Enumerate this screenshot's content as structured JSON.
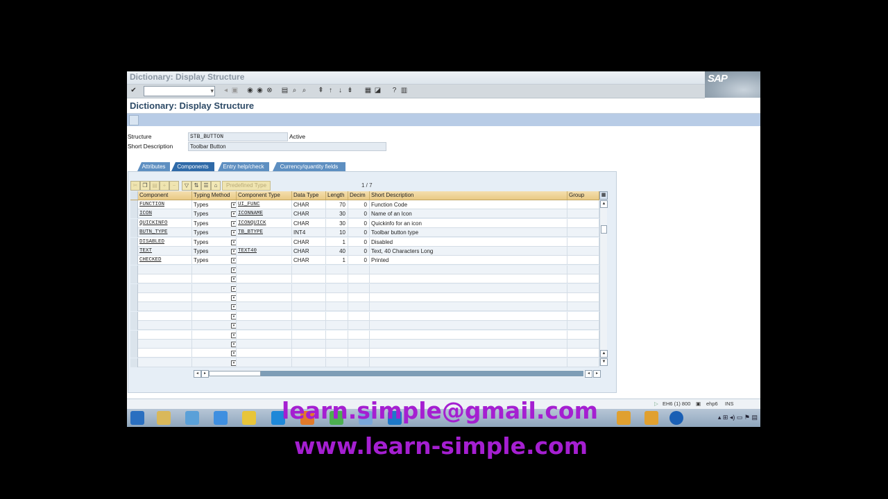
{
  "window": {
    "title": "Dictionary: Display Structure",
    "sap_logo": "SAP"
  },
  "page": {
    "title": "Dictionary: Display Structure"
  },
  "header": {
    "structure_label": "Structure",
    "structure_value": "STB_BUTTON",
    "status": "Active",
    "short_desc_label": "Short Description",
    "short_desc_value": "Toolbar Button"
  },
  "tabs": [
    {
      "label": "Attributes",
      "active": false
    },
    {
      "label": "Components",
      "active": true
    },
    {
      "label": "Entry help/check",
      "active": false
    },
    {
      "label": "Currency/quantity fields",
      "active": false
    }
  ],
  "table_toolbar": {
    "predefined_type_label": "Predefined Type",
    "counter": "1 / 7"
  },
  "columns": [
    "Component",
    "Typing Method",
    "Component Type",
    "Data Type",
    "Length",
    "Decim",
    "Short Description",
    "Group"
  ],
  "rows": [
    {
      "component": "FUNCTION",
      "typing": "Types",
      "comp_type": "UI_FUNC",
      "data_type": "CHAR",
      "length": "70",
      "decim": "0",
      "desc": "Function Code"
    },
    {
      "component": "ICON",
      "typing": "Types",
      "comp_type": "ICONNAME",
      "data_type": "CHAR",
      "length": "30",
      "decim": "0",
      "desc": "Name of an Icon"
    },
    {
      "component": "QUICKINFO",
      "typing": "Types",
      "comp_type": "ICONQUICK",
      "data_type": "CHAR",
      "length": "30",
      "decim": "0",
      "desc": "Quickinfo for an icon"
    },
    {
      "component": "BUTN_TYPE",
      "typing": "Types",
      "comp_type": "TB_BTYPE",
      "data_type": "INT4",
      "length": "10",
      "decim": "0",
      "desc": "Toolbar button type"
    },
    {
      "component": "DISABLED",
      "typing": "Types",
      "comp_type": "",
      "data_type": "CHAR",
      "length": "1",
      "decim": "0",
      "desc": "Disabled"
    },
    {
      "component": "TEXT",
      "typing": "Types",
      "comp_type": "TEXT40",
      "data_type": "CHAR",
      "length": "40",
      "decim": "0",
      "desc": "Text, 40 Characters Long"
    },
    {
      "component": "CHECKED",
      "typing": "Types",
      "comp_type": "",
      "data_type": "CHAR",
      "length": "1",
      "decim": "0",
      "desc": "Printed"
    }
  ],
  "empty_rows": 11,
  "statusbar": {
    "system": "EH6 (1) 800",
    "server": "ehp6",
    "mode": "INS"
  },
  "watermark": {
    "email": "learn.simple@gmail.com",
    "website": "www.learn-simple.com"
  },
  "colors": {
    "watermark": "#a51fd1",
    "sap_blue": "#2f6aa8",
    "header_gold": "#e9c984"
  },
  "icons": {
    "sysbar": [
      "enter-icon",
      "save-icon",
      "back-icon",
      "exit-icon",
      "cancel-icon",
      "print-icon",
      "find-icon",
      "find-next-icon",
      "first-page-icon",
      "prev-page-icon",
      "next-page-icon",
      "last-page-icon",
      "new-session-icon",
      "shortcut-icon",
      "help-icon",
      "layout-icon"
    ]
  }
}
